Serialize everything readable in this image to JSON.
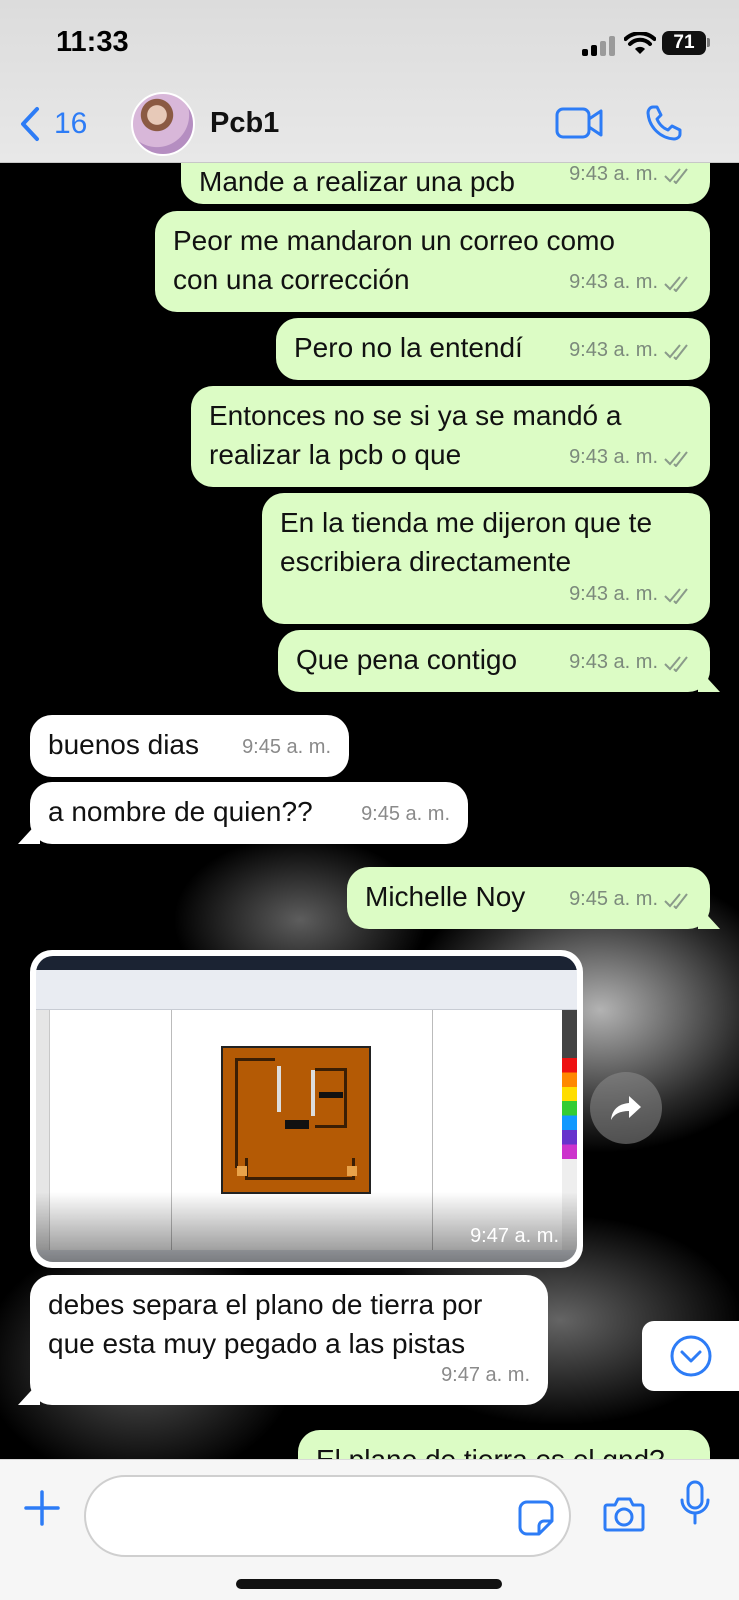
{
  "status_bar": {
    "time": "11:33",
    "battery": "71"
  },
  "header": {
    "back_count": "16",
    "chat_name": "Pcb1"
  },
  "messages": [
    {
      "dir": "out",
      "text": "Mande a realizar una pcb",
      "time": "9:43 a. m."
    },
    {
      "dir": "out",
      "text": "Peor me mandaron un correo como\ncon una corrección",
      "time": "9:43 a. m."
    },
    {
      "dir": "out",
      "text": "Pero no la entendí",
      "time": "9:43 a. m."
    },
    {
      "dir": "out",
      "text": "Entonces no se si ya se mandó a\nrealizar la pcb o que",
      "time": "9:43 a. m."
    },
    {
      "dir": "out",
      "text": "En la tienda me dijeron que te\nescribiera directamente",
      "time": "9:43 a. m."
    },
    {
      "dir": "out",
      "text": "Que pena contigo",
      "time": "9:43 a. m."
    },
    {
      "dir": "in",
      "text": "buenos dias",
      "time": "9:45 a. m."
    },
    {
      "dir": "in",
      "text": "a nombre de quien??",
      "time": "9:45 a. m."
    },
    {
      "dir": "out",
      "text": "Michelle Noy",
      "time": "9:45 a. m."
    },
    {
      "dir": "in",
      "type": "image",
      "time": "9:47 a. m."
    },
    {
      "dir": "in",
      "text": "debes separa el plano de tierra por\nque esta muy pegado a las pistas",
      "time": "9:47 a. m."
    },
    {
      "dir": "out",
      "text": "El plano de tierra es el gnd?",
      "time": ""
    }
  ],
  "icons": [
    "chevron-left-icon",
    "video-call-icon",
    "phone-icon",
    "forward-icon",
    "chevron-down-icon",
    "plus-icon",
    "sticker-icon",
    "camera-icon",
    "microphone-icon"
  ],
  "colors": {
    "accent": "#2d7cf6",
    "outgoing_bubble": "#dcfcc5",
    "incoming_bubble": "#ffffff"
  },
  "composer": {
    "value": ""
  }
}
